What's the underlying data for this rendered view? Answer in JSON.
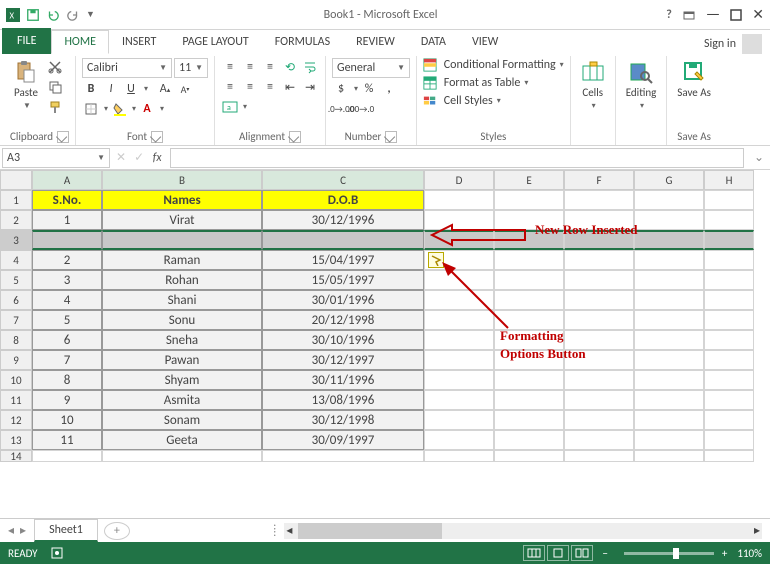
{
  "title": "Book1 - Microsoft Excel",
  "signin": "Sign in",
  "tabs": {
    "file": "FILE",
    "home": "HOME",
    "insert": "INSERT",
    "page": "PAGE LAYOUT",
    "formulas": "FORMULAS",
    "review": "REVIEW",
    "data": "DATA",
    "view": "VIEW"
  },
  "ribbon": {
    "clipboard": {
      "paste": "Paste",
      "label": "Clipboard"
    },
    "font": {
      "name": "Calibri",
      "size": "11",
      "label": "Font"
    },
    "alignment": {
      "label": "Alignment"
    },
    "number": {
      "format": "General",
      "label": "Number"
    },
    "styles": {
      "cond": "Conditional Formatting",
      "table": "Format as Table",
      "cell": "Cell Styles",
      "label": "Styles"
    },
    "cells": {
      "label": "Cells"
    },
    "editing": {
      "label": "Editing"
    },
    "saveas": {
      "btn": "Save As",
      "label": "Save As"
    }
  },
  "namebox": "A3",
  "columns": [
    "A",
    "B",
    "C",
    "D",
    "E",
    "F",
    "G",
    "H"
  ],
  "headers": {
    "a": "S.No.",
    "b": "Names",
    "c": "D.O.B"
  },
  "rows": [
    {
      "n": "1",
      "name": "Virat",
      "dob": "30/12/1996"
    },
    {
      "n": "2",
      "name": "Raman",
      "dob": "15/04/1997"
    },
    {
      "n": "3",
      "name": "Rohan",
      "dob": "15/05/1997"
    },
    {
      "n": "4",
      "name": "Shani",
      "dob": "30/01/1996"
    },
    {
      "n": "5",
      "name": "Sonu",
      "dob": "20/12/1998"
    },
    {
      "n": "6",
      "name": "Sneha",
      "dob": "30/10/1996"
    },
    {
      "n": "7",
      "name": "Pawan",
      "dob": "30/12/1997"
    },
    {
      "n": "8",
      "name": "Shyam",
      "dob": "30/11/1996"
    },
    {
      "n": "9",
      "name": "Asmita",
      "dob": "13/08/1996"
    },
    {
      "n": "10",
      "name": "Sonam",
      "dob": "30/12/1998"
    },
    {
      "n": "11",
      "name": "Geeta",
      "dob": "30/09/1997"
    }
  ],
  "rownums": [
    "1",
    "2",
    "3",
    "4",
    "5",
    "6",
    "7",
    "8",
    "9",
    "10",
    "11",
    "12",
    "13",
    "14"
  ],
  "sheet": "Sheet1",
  "status": "READY",
  "zoom": "110%",
  "annot": {
    "newrow": "New Row Inserted",
    "fmt1": "Formatting",
    "fmt2": "Options Button"
  }
}
